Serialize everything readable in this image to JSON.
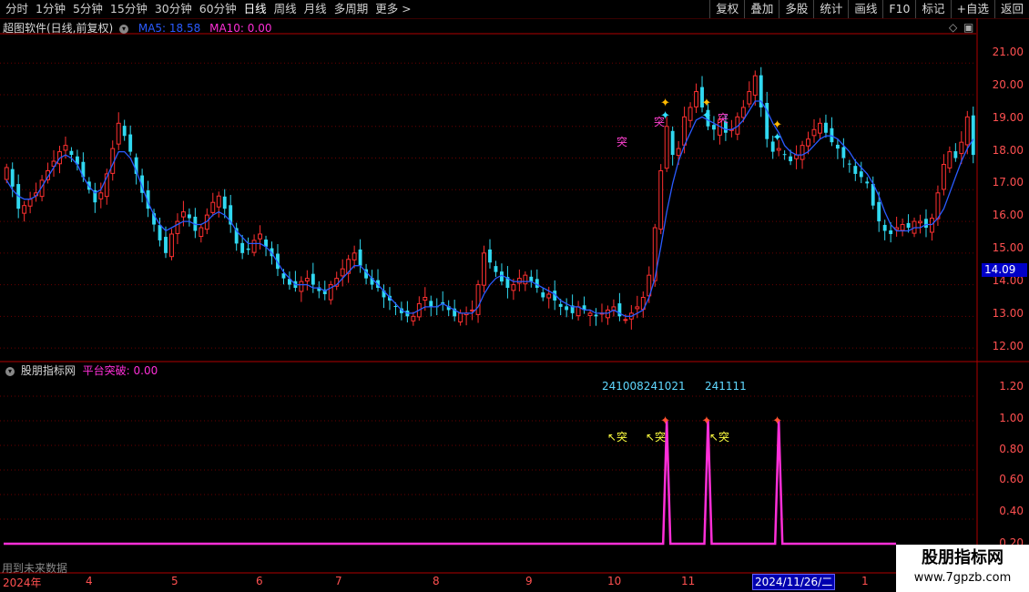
{
  "toolbar": {
    "tabs": [
      "分时",
      "1分钟",
      "5分钟",
      "15分钟",
      "30分钟",
      "60分钟",
      "日线",
      "周线",
      "月线",
      "多周期",
      "更多 >"
    ],
    "active_tab": "日线",
    "tools": [
      "复权",
      "叠加",
      "多股",
      "统计",
      "画线",
      "F10",
      "标记",
      "+自选",
      "返回"
    ]
  },
  "main_panel": {
    "title": "超图软件(日线,前复权)",
    "ma5_label": "MA5: 18.58",
    "ma10_label": "MA10: 0.00",
    "price_axis": [
      "21.00",
      "20.00",
      "19.00",
      "18.00",
      "17.00",
      "16.00",
      "15.00",
      "14.00",
      "13.00",
      "12.00"
    ],
    "current_price": "14.09",
    "signal_marker": "突"
  },
  "indicator_panel": {
    "title": "股朋指标网",
    "indicator_label": "平台突破: 0.00",
    "axis": [
      "1.20",
      "1.00",
      "0.80",
      "0.60",
      "0.40",
      "0.20"
    ],
    "signal_dates": [
      "241008241021",
      "241111"
    ],
    "tu_marker": "↖突",
    "future_note": "用到未来数据"
  },
  "date_axis": {
    "labels": [
      "2024年",
      "4",
      "5",
      "6",
      "7",
      "8",
      "9",
      "10",
      "11",
      "1"
    ],
    "cursor_date": "2024/11/26/二"
  },
  "watermark": {
    "name": "股朋指标网",
    "url": "www.7gpzb.com"
  },
  "colors": {
    "up": "#ff3030",
    "down": "#30d8f0",
    "ma5": "#2a5bff",
    "indicator": "#ff2fd8",
    "grid": "#6a0000"
  },
  "chart_data": {
    "type": "candlestick",
    "closes": [
      17.7,
      17.1,
      16.4,
      16.5,
      16.7,
      16.9,
      17.3,
      17.6,
      17.9,
      18.2,
      18.4,
      18.1,
      17.8,
      17.4,
      17.0,
      16.6,
      16.9,
      17.5,
      18.3,
      19.1,
      18.7,
      18.2,
      17.5,
      16.9,
      16.4,
      15.9,
      15.4,
      15.0,
      15.6,
      16.0,
      16.3,
      16.1,
      15.7,
      15.8,
      16.2,
      16.6,
      16.8,
      16.4,
      15.9,
      15.3,
      15.0,
      15.1,
      15.4,
      15.6,
      15.2,
      14.9,
      14.5,
      14.2,
      14.0,
      13.9,
      14.1,
      14.2,
      14.0,
      13.8,
      13.7,
      14.0,
      14.2,
      14.5,
      14.8,
      15.0,
      14.6,
      14.2,
      14.0,
      13.9,
      13.6,
      13.5,
      13.3,
      13.1,
      13.0,
      13.0,
      13.4,
      13.6,
      13.3,
      13.3,
      13.4,
      13.2,
      13.0,
      13.1,
      13.1,
      13.2,
      14.0,
      15.0,
      14.7,
      14.4,
      14.1,
      13.9,
      14.0,
      14.2,
      14.3,
      14.1,
      13.9,
      13.6,
      13.7,
      13.5,
      13.3,
      13.2,
      13.1,
      13.3,
      13.2,
      13.1,
      13.0,
      13.1,
      13.2,
      13.3,
      13.0,
      12.9,
      13.1,
      13.3,
      13.6,
      14.3,
      15.8,
      17.6,
      19.0,
      18.1,
      18.3,
      19.3,
      19.6,
      20.1,
      19.6,
      19.0,
      18.9,
      19.2,
      18.8,
      18.9,
      19.3,
      19.6,
      20.1,
      20.6,
      19.6,
      18.6,
      18.2,
      18.3,
      18.1,
      17.9,
      18.1,
      18.4,
      18.6,
      18.9,
      19.1,
      18.8,
      18.5,
      18.3,
      18.0,
      17.8,
      17.5,
      17.4,
      17.2,
      16.5,
      16.0,
      15.7,
      15.6,
      15.8,
      15.9,
      15.8,
      16.0,
      16.0,
      15.8,
      16.1,
      16.9,
      17.8,
      18.2,
      18.0,
      18.5,
      19.3,
      18.1
    ],
    "ma5": [
      17.3,
      17.0,
      16.8,
      16.7,
      16.7,
      16.8,
      17.1,
      17.4,
      17.7,
      18.0,
      18.1,
      18.0,
      17.8,
      17.4,
      17.1,
      16.9,
      17.0,
      17.4,
      17.8,
      18.2,
      18.2,
      18.0,
      17.6,
      17.1,
      16.6,
      16.2,
      15.9,
      15.7,
      15.8,
      15.9,
      16.0,
      16.0,
      15.9,
      15.9,
      16.0,
      16.2,
      16.3,
      16.2,
      16.0,
      15.7,
      15.5,
      15.3,
      15.3,
      15.3,
      15.2,
      15.0,
      14.7,
      14.4,
      14.2,
      14.0,
      14.0,
      14.0,
      13.9,
      13.9,
      13.8,
      13.9,
      14.0,
      14.2,
      14.4,
      14.6,
      14.6,
      14.4,
      14.2,
      14.0,
      13.8,
      13.6,
      13.4,
      13.2,
      13.1,
      13.1,
      13.2,
      13.3,
      13.3,
      13.3,
      13.4,
      13.3,
      13.2,
      13.1,
      13.1,
      13.1,
      13.3,
      13.7,
      14.0,
      14.2,
      14.3,
      14.2,
      14.1,
      14.1,
      14.1,
      14.1,
      14.0,
      13.9,
      13.8,
      13.7,
      13.5,
      13.4,
      13.3,
      13.3,
      13.2,
      13.2,
      13.1,
      13.1,
      13.1,
      13.2,
      13.1,
      13.0,
      13.0,
      13.1,
      13.2,
      13.6,
      14.2,
      15.2,
      16.3,
      17.2,
      17.9,
      18.4,
      18.8,
      19.2,
      19.3,
      19.2,
      19.1,
      19.0,
      18.9,
      18.9,
      19.0,
      19.2,
      19.5,
      19.8,
      19.8,
      19.5,
      19.1,
      18.8,
      18.4,
      18.2,
      18.1,
      18.1,
      18.2,
      18.4,
      18.6,
      18.7,
      18.7,
      18.6,
      18.4,
      18.2,
      17.9,
      17.7,
      17.5,
      17.2,
      16.8,
      16.3,
      15.9,
      15.7,
      15.7,
      15.7,
      15.8,
      15.8,
      15.9,
      15.9,
      16.1,
      16.4,
      16.9,
      17.4,
      17.9,
      18.3,
      18.6
    ],
    "ylim": [
      11.6,
      21.9
    ],
    "indicator_series": {
      "name": "平台突破",
      "values": [
        0,
        1,
        0,
        1,
        0,
        1,
        0
      ],
      "x_index": [
        0,
        112,
        114,
        119,
        121,
        131,
        133
      ]
    },
    "signal_indices": [
      112,
      119,
      131
    ]
  }
}
